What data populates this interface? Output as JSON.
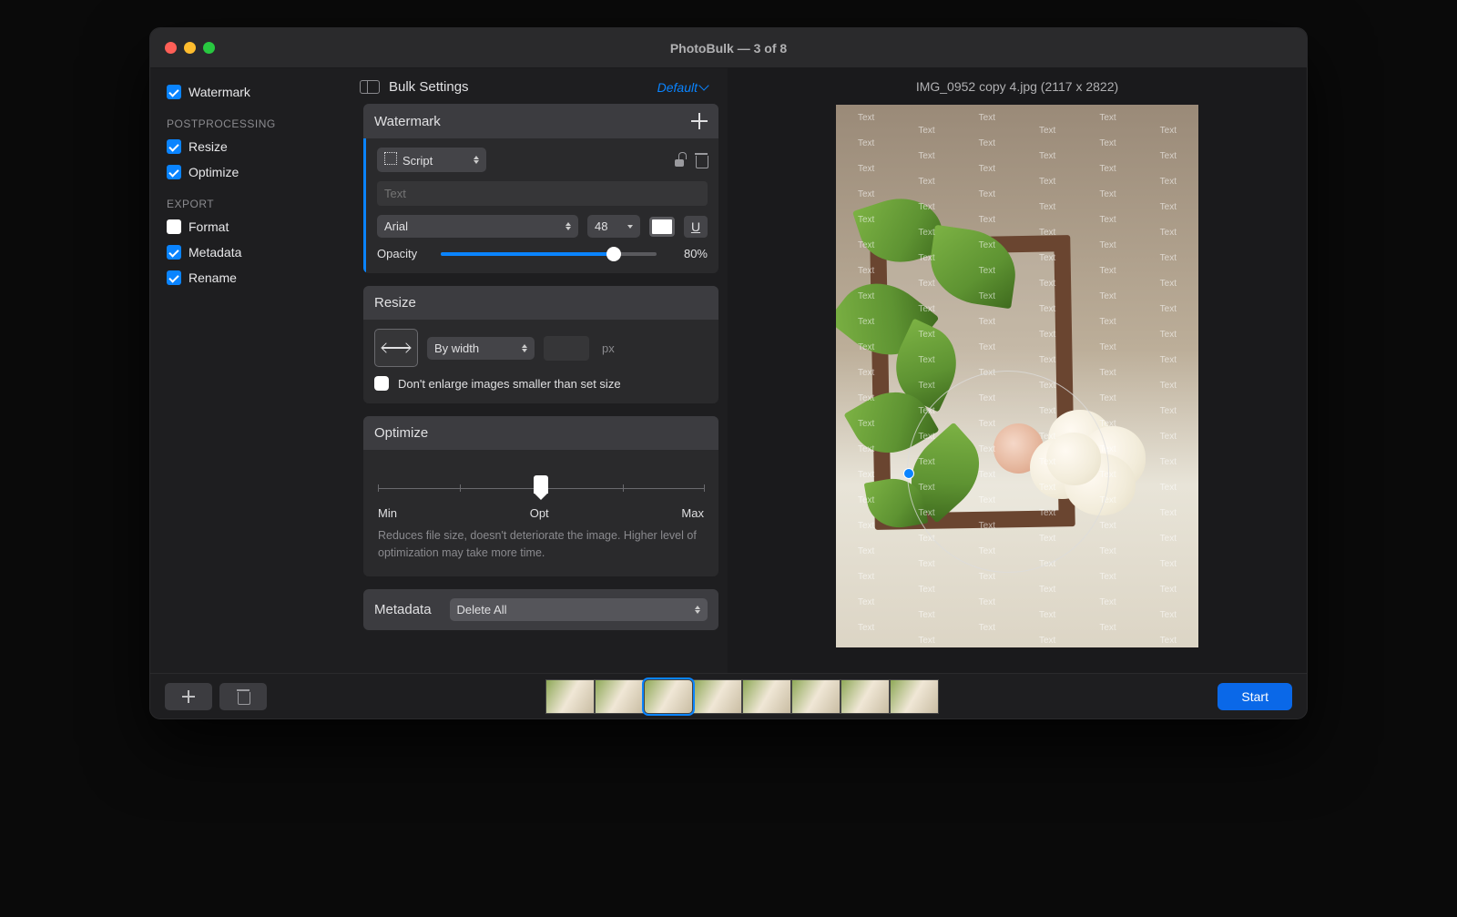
{
  "window": {
    "title": "PhotoBulk — 3 of 8"
  },
  "sidebar": {
    "items_top": [
      {
        "label": "Watermark",
        "checked": true
      }
    ],
    "groups": [
      {
        "label": "POSTPROCESSING",
        "items": [
          {
            "label": "Resize",
            "checked": true
          },
          {
            "label": "Optimize",
            "checked": true
          }
        ]
      },
      {
        "label": "EXPORT",
        "items": [
          {
            "label": "Format",
            "checked": false
          },
          {
            "label": "Metadata",
            "checked": true
          },
          {
            "label": "Rename",
            "checked": true
          }
        ]
      }
    ]
  },
  "settings": {
    "heading": "Bulk Settings",
    "preset_label": "Default",
    "watermark": {
      "title": "Watermark",
      "type_label": "Script",
      "text_placeholder": "Text",
      "text_value": "",
      "font_label": "Arial",
      "font_size": "48",
      "opacity_label": "Opacity",
      "opacity_value": "80%",
      "opacity_pct": 80
    },
    "resize": {
      "title": "Resize",
      "mode_label": "By width",
      "value": "",
      "unit": "px",
      "checkbox_label": "Don't enlarge images smaller than set size",
      "checkbox_checked": false
    },
    "optimize": {
      "title": "Optimize",
      "min_label": "Min",
      "opt_label": "Opt",
      "max_label": "Max",
      "description": "Reduces file size, doesn't deteriorate the image. Higher level of optimization may take more time."
    },
    "metadata": {
      "title": "Metadata",
      "mode_label": "Delete All"
    }
  },
  "preview": {
    "filename": "IMG_0952 copy 4.jpg (2117 x 2822)",
    "overlay_text": "Text"
  },
  "footer": {
    "thumb_count": 8,
    "selected_index": 2,
    "start_label": "Start"
  }
}
